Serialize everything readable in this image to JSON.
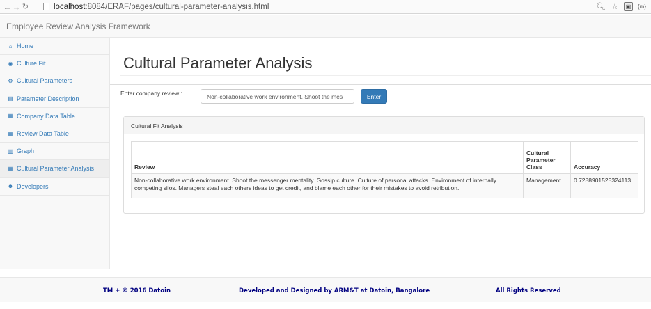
{
  "browser": {
    "url_host": "localhost",
    "url_rest": ":8084/ERAF/pages/cultural-parameter-analysis.html",
    "ext_label": "{m}"
  },
  "app": {
    "brand": "Employee Review Analysis Framework"
  },
  "sidebar": {
    "items": [
      {
        "label": "Home",
        "icon": "home-icon",
        "glyph": "⌂"
      },
      {
        "label": "Culture Fit",
        "icon": "binoculars-icon",
        "glyph": "◉"
      },
      {
        "label": "Cultural Parameters",
        "icon": "cogs-icon",
        "glyph": "⚙"
      },
      {
        "label": "Parameter Description",
        "icon": "file-icon",
        "glyph": "▤"
      },
      {
        "label": "Company Data Table",
        "icon": "table-icon",
        "glyph": "▦"
      },
      {
        "label": "Review Data Table",
        "icon": "table-icon",
        "glyph": "▦"
      },
      {
        "label": "Graph",
        "icon": "bar-chart-icon",
        "glyph": "▥"
      },
      {
        "label": "Cultural Parameter Analysis",
        "icon": "table-icon",
        "glyph": "▦",
        "active": true
      },
      {
        "label": "Developers",
        "icon": "users-icon",
        "glyph": "☻"
      }
    ]
  },
  "main": {
    "title": "Cultural Parameter Analysis",
    "form_label": "Enter company review :",
    "input_value": "Non-collaborative work environment. Shoot the mes",
    "enter_label": "Enter",
    "panel_title": "Cultural Fit Analysis",
    "table": {
      "headers": [
        "Review",
        "Cultural Parameter Class",
        "Accuracy"
      ],
      "rows": [
        [
          "Non-collaborative work environment. Shoot the messenger mentality. Gossip culture. Culture of personal attacks. Environment of internally competing silos. Managers steal each others ideas to get credit, and blame each other for their mistakes to avoid retribution.",
          "Management",
          "0.7288901525324113"
        ]
      ]
    }
  },
  "footer": {
    "left": "TM + © 2016 Datoin",
    "center": "Developed and Designed by ARM&T at Datoin, Bangalore",
    "right": "All Rights Reserved"
  }
}
